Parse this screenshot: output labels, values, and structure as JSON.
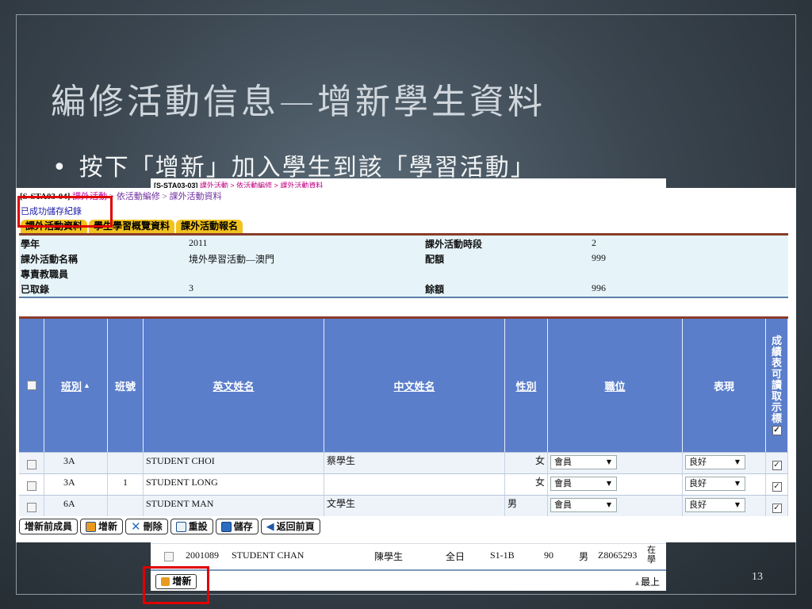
{
  "slide": {
    "title": "編修活動信息—增新學生資料",
    "bullet": "按下「增新」加入學生到該「學習活動」",
    "page_number": "13"
  },
  "back_window": {
    "breadcrumb_code": "[S-STA03-03]",
    "breadcrumb_path": "課外活動 > 依活動編修 > 課外活動資料",
    "row": {
      "id": "2001089",
      "eng": "STUDENT CHAN",
      "chi": "陳學生",
      "mode": "全日",
      "cls": "S1-1B",
      "num": "90",
      "sex": "男",
      "hkid": "Z8065293",
      "status": "在學"
    },
    "add_label": "增新",
    "top_label": "最上"
  },
  "main_window": {
    "breadcrumb_code": "[S-STA03-04]",
    "breadcrumb_path1": "課外活動",
    "breadcrumb_path2": " > 依活動編修 > 課外活動資料",
    "saved_msg": "已成功儲存紀錄",
    "tabs": [
      "課外活動資料",
      "學生學習概覽資料",
      "課外活動報名"
    ],
    "info": {
      "year_label": "學年",
      "year": "2011",
      "name_label": "課外活動名稱",
      "name": "境外學習活動—澳門",
      "staff_label": "專責教職員",
      "enrolled_label": "已取錄",
      "enrolled": "3",
      "period_label": "課外活動時段",
      "period": "2",
      "quota_label": "配額",
      "quota": "999",
      "remain_label": "餘額",
      "remain": "996"
    },
    "headers": {
      "cls": "班別",
      "clsno": "班號",
      "eng": "英文姓名",
      "chi": "中文姓名",
      "sex": "性別",
      "post": "職位",
      "perf": "表現",
      "report": "成績表可讀取示標"
    },
    "rows": [
      {
        "cls": "3A",
        "no": "",
        "eng": "STUDENT CHOI",
        "chi": "蔡學生",
        "sex": "女",
        "post": "會員",
        "perf": "良好"
      },
      {
        "cls": "3A",
        "no": "1",
        "eng": "STUDENT LONG",
        "chi": "",
        "sex": "女",
        "post": "會員",
        "perf": "良好"
      },
      {
        "cls": "6A",
        "no": "",
        "eng": "STUDENT MAN",
        "chi": "文學生",
        "sex": "男",
        "post": "會員",
        "perf": "良好"
      }
    ],
    "toolbar": {
      "add_prev": "增新前成員",
      "add": "增新",
      "del": "刪除",
      "reset": "重設",
      "save": "儲存",
      "back": "返回前頁"
    }
  },
  "colors": {
    "header_blue": "#5b7ecb",
    "tab_yellow": "#f2c21e",
    "highlight_red": "#e00000"
  }
}
